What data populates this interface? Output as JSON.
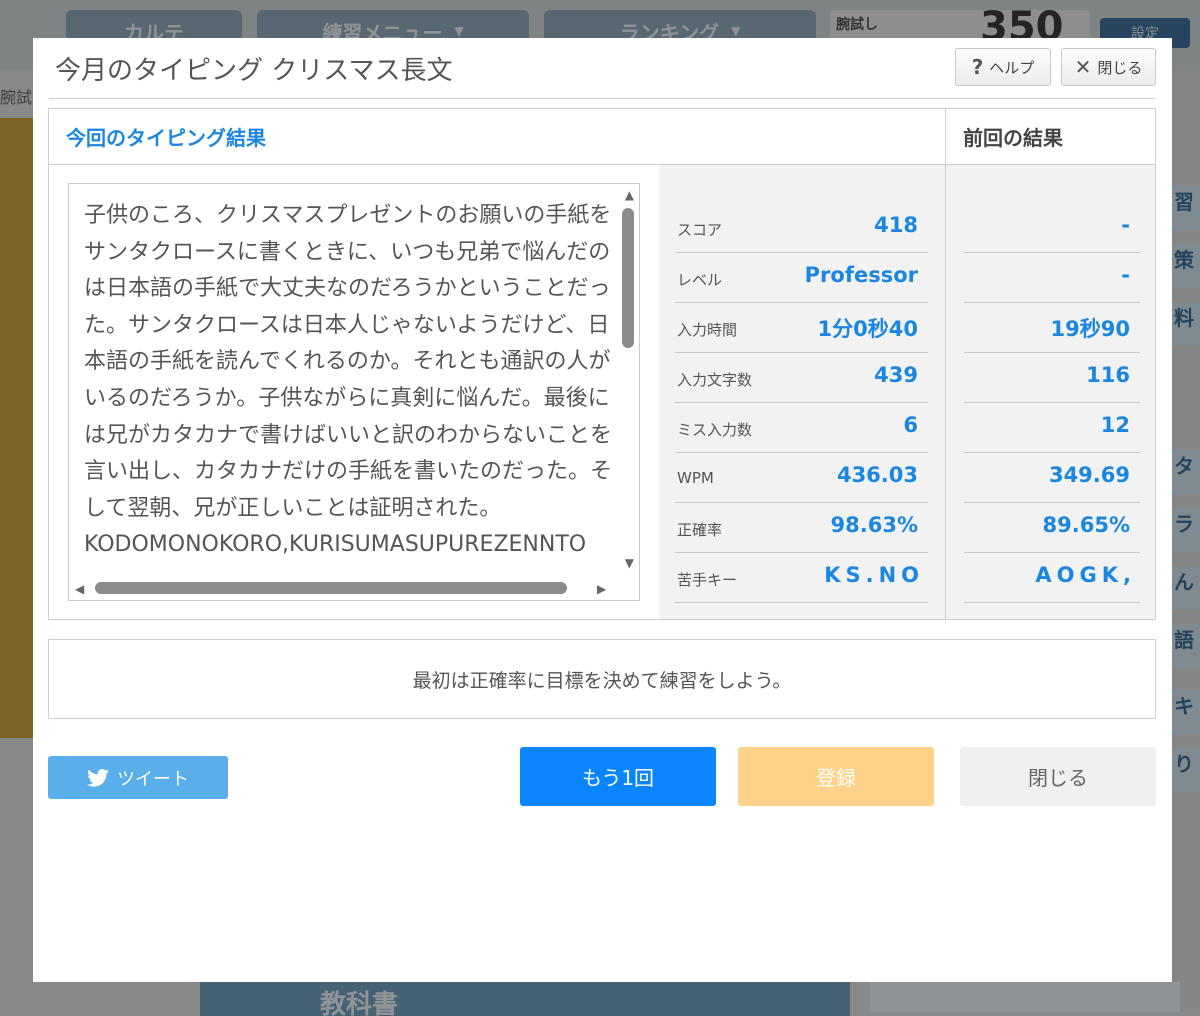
{
  "background": {
    "nav": [
      {
        "label": "カルテ"
      },
      {
        "label": "練習メニュー"
      },
      {
        "label": "ランキング"
      }
    ],
    "score_label": "腕試し",
    "score_value": "350",
    "setting_label": "設定",
    "left_label": "腕試し",
    "right_items": [
      "習",
      "策",
      "料",
      "タ",
      "ラ",
      "ん",
      "語",
      "キ",
      "り"
    ],
    "bottom_banner": "教科書"
  },
  "modal": {
    "title": "今月のタイピング クリスマス長文",
    "help_label": "ヘルプ",
    "close_label": "閉じる",
    "current_heading": "今回のタイピング結果",
    "previous_heading": "前回の結果",
    "passage": "子供のころ、クリスマスプレゼントのお願いの手紙をサンタクロースに書くときに、いつも兄弟で悩んだのは日本語の手紙で大丈夫なのだろうかということだった。サンタクロースは日本人じゃないようだけど、日本語の手紙を読んでくれるのか。それとも通訳の人がいるのだろうか。子供ながらに真剣に悩んだ。最後には兄がカタカナで書けばいいと訳のわからないことを言い出し、カタカナだけの手紙を書いたのだった。そして翌朝、兄が正しいことは証明された。\nKODOMONOKORO,KURISUMASUPUREZENNTO",
    "stats": [
      {
        "label": "スコア",
        "current": "418",
        "previous": "-"
      },
      {
        "label": "レベル",
        "current": "Professor",
        "previous": "-"
      },
      {
        "label": "入力時間",
        "current": "1分0秒40",
        "previous": "19秒90"
      },
      {
        "label": "入力文字数",
        "current": "439",
        "previous": "116"
      },
      {
        "label": "ミス入力数",
        "current": "6",
        "previous": "12"
      },
      {
        "label": "WPM",
        "current": "436.03",
        "previous": "349.69"
      },
      {
        "label": "正確率",
        "current": "98.63%",
        "previous": "89.65%"
      },
      {
        "label": "苦手キー",
        "current": "KS.NO",
        "previous": "AOGK,"
      }
    ],
    "message": "最初は正確率に目標を決めて練習をしよう。",
    "tweet_label": "ツイート",
    "retry_label": "もう1回",
    "register_label": "登録",
    "close_button_label": "閉じる"
  },
  "colors": {
    "accent": "#1a86e0",
    "primary_button": "#0a84ff",
    "register_button": "#ffd28a",
    "tweet_button": "#5aaee9"
  }
}
